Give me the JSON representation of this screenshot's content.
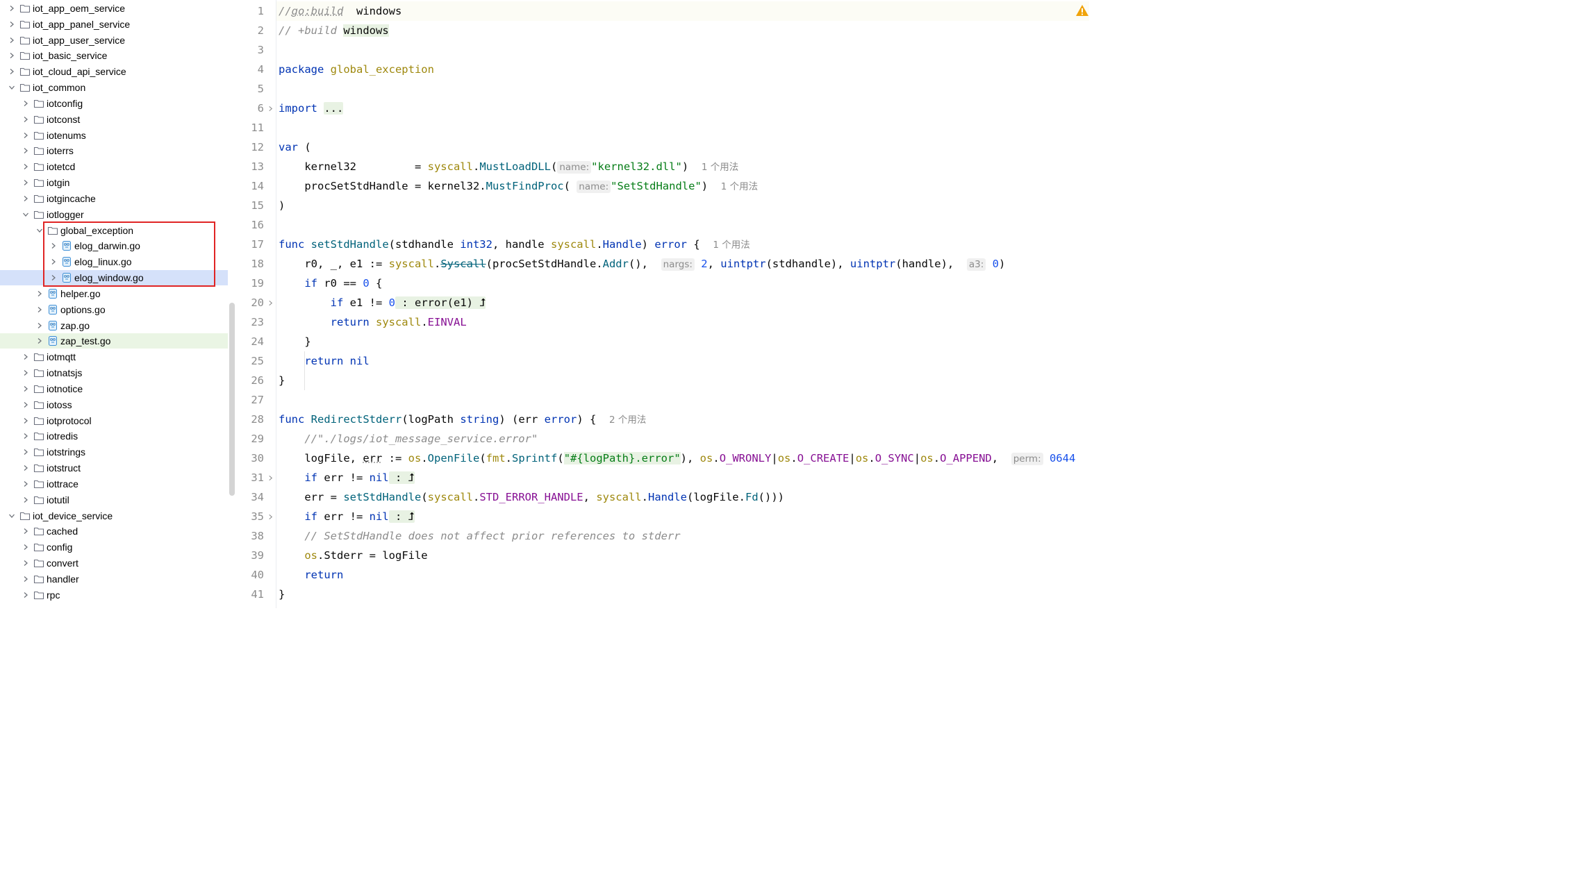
{
  "tree": {
    "items": [
      {
        "label": "iot_app_oem_service",
        "type": "folder",
        "depth": 0,
        "expanded": false
      },
      {
        "label": "iot_app_panel_service",
        "type": "folder",
        "depth": 0,
        "expanded": false
      },
      {
        "label": "iot_app_user_service",
        "type": "folder",
        "depth": 0,
        "expanded": false
      },
      {
        "label": "iot_basic_service",
        "type": "folder",
        "depth": 0,
        "expanded": false
      },
      {
        "label": "iot_cloud_api_service",
        "type": "folder",
        "depth": 0,
        "expanded": false
      },
      {
        "label": "iot_common",
        "type": "folder",
        "depth": 0,
        "expanded": true
      },
      {
        "label": "iotconfig",
        "type": "folder",
        "depth": 1,
        "expanded": false
      },
      {
        "label": "iotconst",
        "type": "folder",
        "depth": 1,
        "expanded": false
      },
      {
        "label": "iotenums",
        "type": "folder",
        "depth": 1,
        "expanded": false
      },
      {
        "label": "ioterrs",
        "type": "folder",
        "depth": 1,
        "expanded": false
      },
      {
        "label": "iotetcd",
        "type": "folder",
        "depth": 1,
        "expanded": false
      },
      {
        "label": "iotgin",
        "type": "folder",
        "depth": 1,
        "expanded": false
      },
      {
        "label": "iotgincache",
        "type": "folder",
        "depth": 1,
        "expanded": false
      },
      {
        "label": "iotlogger",
        "type": "folder",
        "depth": 1,
        "expanded": true
      },
      {
        "label": "global_exception",
        "type": "folder",
        "depth": 2,
        "expanded": true
      },
      {
        "label": "elog_darwin.go",
        "type": "gofile",
        "depth": 3,
        "expanded": false
      },
      {
        "label": "elog_linux.go",
        "type": "gofile",
        "depth": 3,
        "expanded": false
      },
      {
        "label": "elog_window.go",
        "type": "gofile",
        "depth": 3,
        "expanded": false,
        "selected": true
      },
      {
        "label": "helper.go",
        "type": "gofile",
        "depth": 2,
        "expanded": false
      },
      {
        "label": "options.go",
        "type": "gofile",
        "depth": 2,
        "expanded": false
      },
      {
        "label": "zap.go",
        "type": "gofile",
        "depth": 2,
        "expanded": false
      },
      {
        "label": "zap_test.go",
        "type": "gofile",
        "depth": 2,
        "expanded": false,
        "modified": true
      },
      {
        "label": "iotmqtt",
        "type": "folder",
        "depth": 1,
        "expanded": false
      },
      {
        "label": "iotnatsjs",
        "type": "folder",
        "depth": 1,
        "expanded": false
      },
      {
        "label": "iotnotice",
        "type": "folder",
        "depth": 1,
        "expanded": false
      },
      {
        "label": "iotoss",
        "type": "folder",
        "depth": 1,
        "expanded": false
      },
      {
        "label": "iotprotocol",
        "type": "folder",
        "depth": 1,
        "expanded": false
      },
      {
        "label": "iotredis",
        "type": "folder",
        "depth": 1,
        "expanded": false
      },
      {
        "label": "iotstrings",
        "type": "folder",
        "depth": 1,
        "expanded": false
      },
      {
        "label": "iotstruct",
        "type": "folder",
        "depth": 1,
        "expanded": false
      },
      {
        "label": "iottrace",
        "type": "folder",
        "depth": 1,
        "expanded": false
      },
      {
        "label": "iotutil",
        "type": "folder",
        "depth": 1,
        "expanded": false
      },
      {
        "label": "iot_device_service",
        "type": "folder",
        "depth": 0,
        "expanded": true
      },
      {
        "label": "cached",
        "type": "folder",
        "depth": 1,
        "expanded": false
      },
      {
        "label": "config",
        "type": "folder",
        "depth": 1,
        "expanded": false
      },
      {
        "label": "convert",
        "type": "folder",
        "depth": 1,
        "expanded": false
      },
      {
        "label": "handler",
        "type": "folder",
        "depth": 1,
        "expanded": false
      },
      {
        "label": "rpc",
        "type": "folder",
        "depth": 1,
        "expanded": false
      }
    ]
  },
  "editor": {
    "lines": [
      {
        "n": "1",
        "tokens": [
          [
            "cmt",
            "//"
          ],
          [
            "cmt underline-dotted",
            "go:build"
          ],
          [
            "",
            "  windows"
          ]
        ]
      },
      {
        "n": "2",
        "tokens": [
          [
            "cmt",
            "// +build "
          ],
          [
            "green-bg",
            "windows"
          ]
        ]
      },
      {
        "n": "3",
        "tokens": []
      },
      {
        "n": "4",
        "tokens": [
          [
            "kw",
            "package "
          ],
          [
            "pkg",
            "global_exception"
          ]
        ]
      },
      {
        "n": "5",
        "tokens": []
      },
      {
        "n": "6",
        "fold": true,
        "tokens": [
          [
            "kw",
            "import "
          ],
          [
            "folded",
            "..."
          ]
        ]
      },
      {
        "n": "11",
        "tokens": []
      },
      {
        "n": "12",
        "tokens": [
          [
            "kw",
            "var "
          ],
          [
            "",
            "("
          ]
        ]
      },
      {
        "n": "13",
        "tokens": [
          [
            "",
            "    kernel32         = "
          ],
          [
            "pkg",
            "syscall"
          ],
          [
            "",
            "."
          ],
          [
            "call",
            "MustLoadDLL"
          ],
          [
            "",
            "("
          ],
          [
            "hint",
            "name:"
          ],
          [
            "str",
            "\"kernel32.dll\""
          ],
          [
            "",
            ")  "
          ],
          [
            "usage",
            "1 个用法"
          ]
        ]
      },
      {
        "n": "14",
        "tokens": [
          [
            "",
            "    procSetStdHandle = kernel32."
          ],
          [
            "call",
            "MustFindProc"
          ],
          [
            "",
            "( "
          ],
          [
            "hint",
            "name:"
          ],
          [
            "str",
            "\"SetStdHandle\""
          ],
          [
            "",
            ")  "
          ],
          [
            "usage",
            "1 个用法"
          ]
        ]
      },
      {
        "n": "15",
        "tokens": [
          [
            "",
            ")"
          ]
        ]
      },
      {
        "n": "16",
        "tokens": []
      },
      {
        "n": "17",
        "tokens": [
          [
            "kw",
            "func "
          ],
          [
            "fn",
            "setStdHandle"
          ],
          [
            "",
            "(stdhandle "
          ],
          [
            "typ",
            "int32"
          ],
          [
            "",
            ", handle "
          ],
          [
            "pkg",
            "syscall"
          ],
          [
            "",
            "."
          ],
          [
            "typ",
            "Handle"
          ],
          [
            "",
            ") "
          ],
          [
            "typ",
            "error"
          ],
          [
            "",
            " {  "
          ],
          [
            "usage",
            "1 个用法"
          ]
        ]
      },
      {
        "n": "18",
        "tokens": [
          [
            "",
            "    r0, _, e1 := "
          ],
          [
            "pkg",
            "syscall"
          ],
          [
            "",
            "."
          ],
          [
            "call strike",
            "Syscall"
          ],
          [
            "",
            "(procSetStdHandle."
          ],
          [
            "call",
            "Addr"
          ],
          [
            "",
            "(),  "
          ],
          [
            "hint",
            "nargs:"
          ],
          [
            "num",
            " 2"
          ],
          [
            "",
            ", "
          ],
          [
            "typ",
            "uintptr"
          ],
          [
            "",
            "(stdhandle), "
          ],
          [
            "typ",
            "uintptr"
          ],
          [
            "",
            "(handle),  "
          ],
          [
            "hint",
            "a3:"
          ],
          [
            "num",
            " 0"
          ],
          [
            "",
            ")"
          ]
        ]
      },
      {
        "n": "19",
        "tokens": [
          [
            "",
            "    "
          ],
          [
            "kw",
            "if "
          ],
          [
            "",
            "r0 == "
          ],
          [
            "num",
            "0"
          ],
          [
            "",
            " {"
          ]
        ]
      },
      {
        "n": "20",
        "fold": true,
        "tokens": [
          [
            "",
            "        "
          ],
          [
            "kw",
            "if "
          ],
          [
            "",
            "e1 != "
          ],
          [
            "num",
            "0"
          ],
          [
            "folded",
            " : error(e1) ⮥"
          ]
        ]
      },
      {
        "n": "23",
        "tokens": [
          [
            "",
            "        "
          ],
          [
            "kw",
            "return "
          ],
          [
            "pkg",
            "syscall"
          ],
          [
            "",
            "."
          ],
          [
            "const",
            "EINVAL"
          ]
        ]
      },
      {
        "n": "24",
        "tokens": [
          [
            "",
            "    }"
          ]
        ]
      },
      {
        "n": "25",
        "tokens": [
          [
            "",
            "    "
          ],
          [
            "kw",
            "return "
          ],
          [
            "kw",
            "nil"
          ]
        ]
      },
      {
        "n": "26",
        "tokens": [
          [
            "",
            "}"
          ]
        ]
      },
      {
        "n": "27",
        "tokens": []
      },
      {
        "n": "28",
        "tokens": [
          [
            "kw",
            "func "
          ],
          [
            "fn",
            "RedirectStderr"
          ],
          [
            "",
            "(logPath "
          ],
          [
            "typ",
            "string"
          ],
          [
            "",
            ") (err "
          ],
          [
            "typ",
            "error"
          ],
          [
            "",
            ") {  "
          ],
          [
            "usage",
            "2 个用法"
          ]
        ]
      },
      {
        "n": "29",
        "tokens": [
          [
            "",
            "    "
          ],
          [
            "cmt",
            "//\"./logs/iot_message_service.error\""
          ]
        ]
      },
      {
        "n": "30",
        "tokens": [
          [
            "",
            "    logFile, "
          ],
          [
            "underline-dotted",
            "err"
          ],
          [
            "",
            " := "
          ],
          [
            "pkg",
            "os"
          ],
          [
            "",
            "."
          ],
          [
            "call",
            "OpenFile"
          ],
          [
            "",
            "("
          ],
          [
            "pkg",
            "fmt"
          ],
          [
            "",
            "."
          ],
          [
            "call",
            "Sprintf"
          ],
          [
            "",
            "("
          ],
          [
            "str green-bg",
            "\"#{logPath}.error\""
          ],
          [
            "",
            "), "
          ],
          [
            "pkg",
            "os"
          ],
          [
            "",
            "."
          ],
          [
            "const",
            "O_WRONLY"
          ],
          [
            "",
            "|"
          ],
          [
            "pkg",
            "os"
          ],
          [
            "",
            "."
          ],
          [
            "const",
            "O_CREATE"
          ],
          [
            "",
            "|"
          ],
          [
            "pkg",
            "os"
          ],
          [
            "",
            "."
          ],
          [
            "const",
            "O_SYNC"
          ],
          [
            "",
            "|"
          ],
          [
            "pkg",
            "os"
          ],
          [
            "",
            "."
          ],
          [
            "const",
            "O_APPEND"
          ],
          [
            "",
            ",  "
          ],
          [
            "hint",
            "perm:"
          ],
          [
            "num",
            " 0644"
          ]
        ]
      },
      {
        "n": "31",
        "fold": true,
        "tokens": [
          [
            "",
            "    "
          ],
          [
            "kw",
            "if "
          ],
          [
            "",
            "err != "
          ],
          [
            "kw",
            "nil"
          ],
          [
            "folded",
            " : ⮥"
          ]
        ]
      },
      {
        "n": "34",
        "tokens": [
          [
            "",
            "    err = "
          ],
          [
            "call",
            "setStdHandle"
          ],
          [
            "",
            "("
          ],
          [
            "pkg",
            "syscall"
          ],
          [
            "",
            "."
          ],
          [
            "const",
            "STD_ERROR_HANDLE"
          ],
          [
            "",
            ", "
          ],
          [
            "pkg",
            "syscall"
          ],
          [
            "",
            "."
          ],
          [
            "typ",
            "Handle"
          ],
          [
            "",
            "(logFile."
          ],
          [
            "call",
            "Fd"
          ],
          [
            "",
            "()))"
          ]
        ]
      },
      {
        "n": "35",
        "fold": true,
        "tokens": [
          [
            "",
            "    "
          ],
          [
            "kw",
            "if "
          ],
          [
            "",
            "err != "
          ],
          [
            "kw",
            "nil"
          ],
          [
            "folded",
            " : ⮥"
          ]
        ]
      },
      {
        "n": "38",
        "tokens": [
          [
            "",
            "    "
          ],
          [
            "cmt",
            "// SetStdHandle does not affect prior references to stderr"
          ]
        ]
      },
      {
        "n": "39",
        "tokens": [
          [
            "",
            "    "
          ],
          [
            "pkg",
            "os"
          ],
          [
            "",
            ".Stderr = logFile"
          ]
        ]
      },
      {
        "n": "40",
        "tokens": [
          [
            "",
            "    "
          ],
          [
            "kw",
            "return"
          ]
        ]
      },
      {
        "n": "41",
        "tokens": [
          [
            "",
            "}"
          ]
        ]
      }
    ]
  },
  "colors": {
    "highlight_box": "#e02424",
    "selected_row": "#d5e1fa",
    "modified_row": "#eaf5e4",
    "warning": "#f0a30a"
  }
}
